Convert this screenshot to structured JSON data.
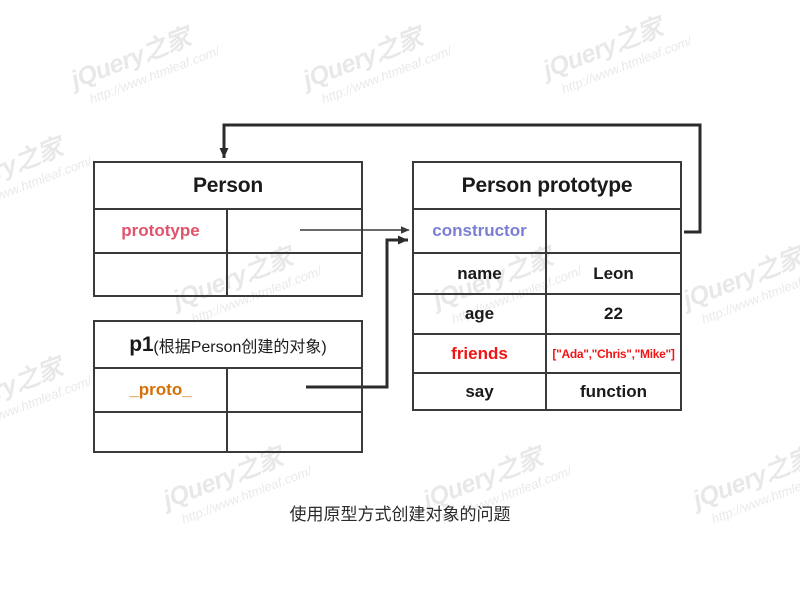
{
  "caption": "使用原型方式创建对象的问题",
  "watermark": {
    "brand": "jQuery之家",
    "url": "http://www.htmleaf.com/"
  },
  "colors": {
    "border": "#3a3a3a",
    "text": "#1a1a1a",
    "prototype_key": "#e2526b",
    "constructor_key": "#7b7fd4",
    "friends_key": "#f01414",
    "proto_key": "#d4700a",
    "background": "#ffffff"
  },
  "boxes": {
    "person": {
      "title": "Person",
      "rows": [
        {
          "key": "prototype",
          "value": ""
        },
        {
          "key": "",
          "value": ""
        }
      ]
    },
    "p1": {
      "title": "p1",
      "title_suffix": "(根据Person创建的对象)",
      "rows": [
        {
          "key": "_proto_",
          "value": ""
        },
        {
          "key": "",
          "value": ""
        }
      ]
    },
    "person_prototype": {
      "title": "Person prototype",
      "rows": [
        {
          "key": "constructor",
          "value": ""
        },
        {
          "key": "name",
          "value": "Leon"
        },
        {
          "key": "age",
          "value": "22"
        },
        {
          "key": "friends",
          "value": "[\"Ada\",\"Chris\",\"Mike\"]"
        },
        {
          "key": "say",
          "value": "function"
        }
      ]
    }
  },
  "connectors": [
    {
      "name": "person-prototype-to-prototype-box",
      "from": "Person.prototype",
      "to": "Person prototype"
    },
    {
      "name": "p1-proto-to-prototype-box",
      "from": "p1._proto_",
      "to": "Person prototype"
    },
    {
      "name": "constructor-to-person-box",
      "from": "Person prototype.constructor",
      "to": "Person"
    }
  ]
}
